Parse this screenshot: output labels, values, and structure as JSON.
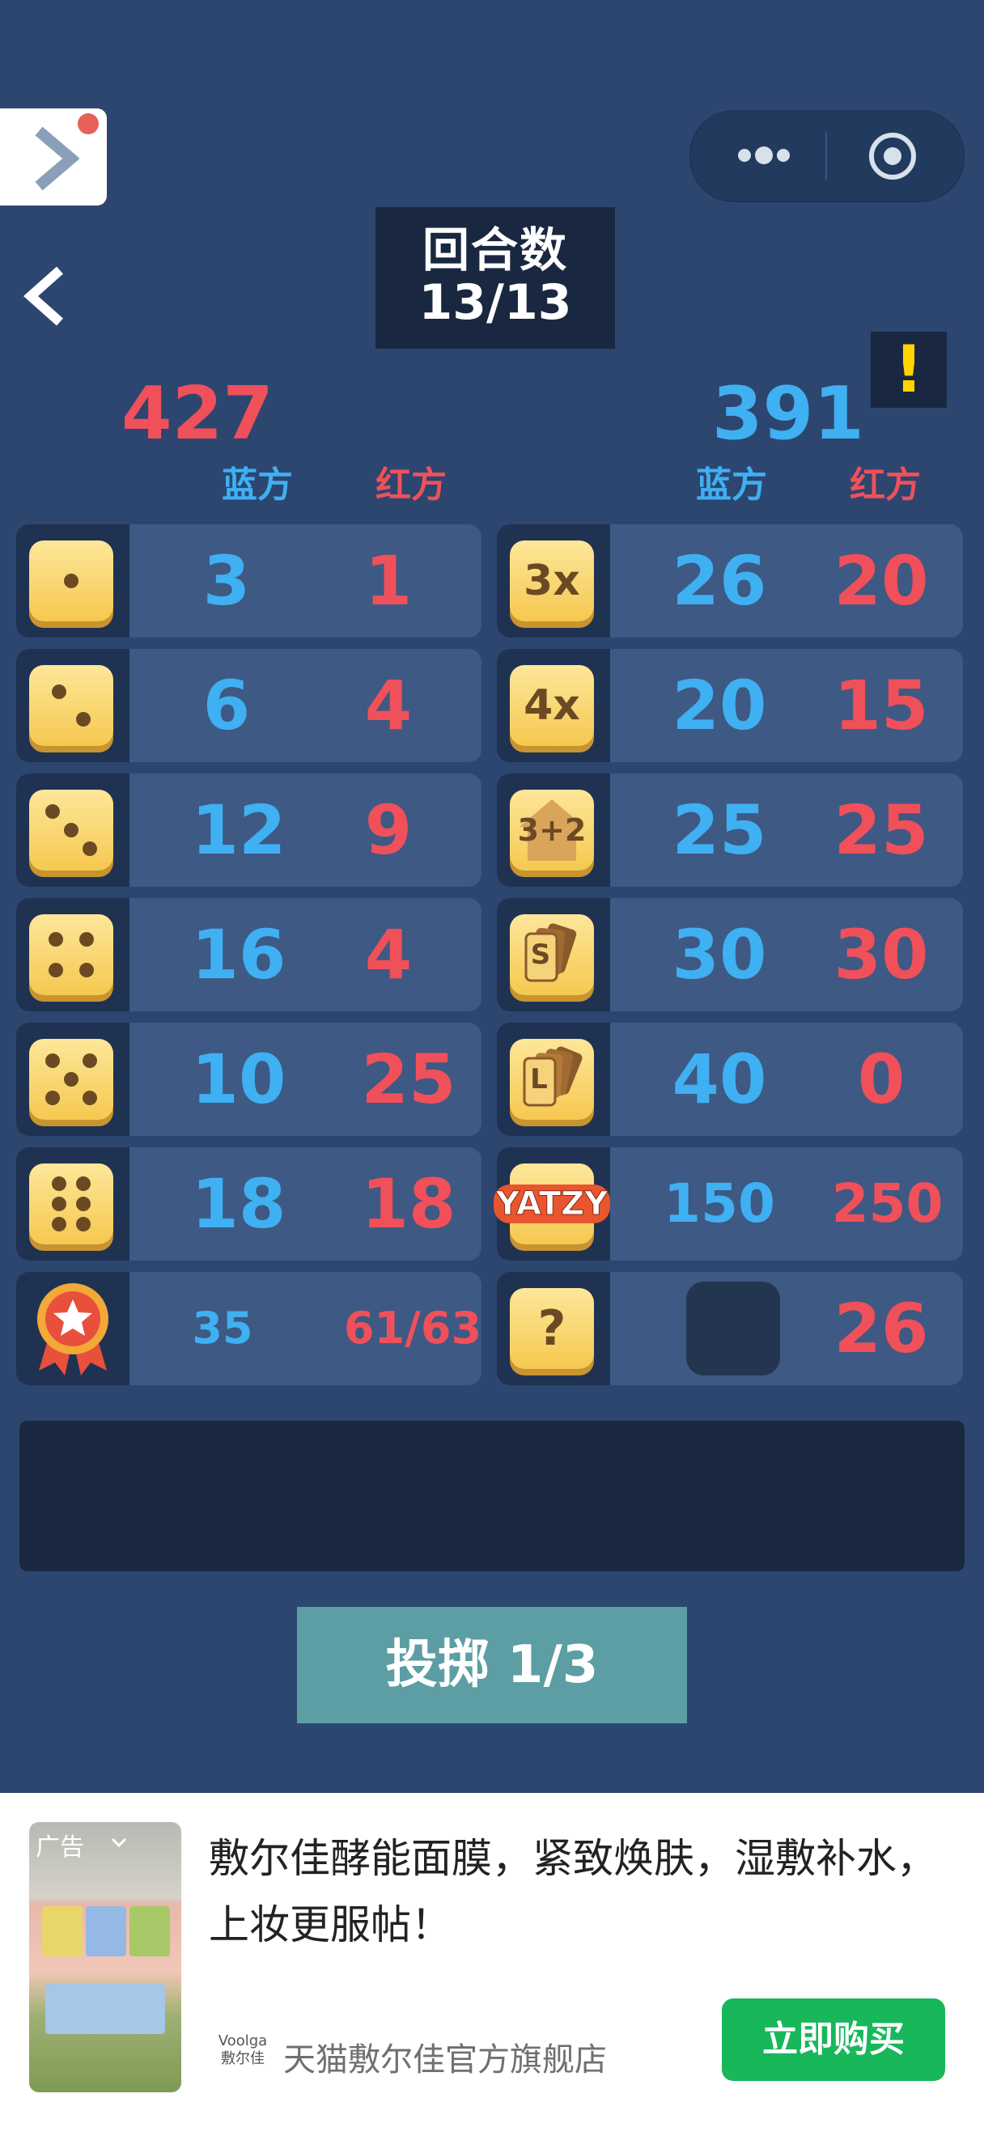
{
  "nav": {
    "icon": "chevron-right-icon",
    "back_icon": "chevron-left-icon",
    "menu_icon": "more-dots-icon",
    "close_icon": "target-circle-icon"
  },
  "round": {
    "label": "回合数",
    "value": "13/13"
  },
  "alert": "!",
  "totals": {
    "left": "427",
    "right": "391"
  },
  "headers": {
    "blue": "蓝方",
    "red": "红方"
  },
  "left_rows": [
    {
      "icon": "dice-one-icon",
      "blue": "3",
      "red": "1"
    },
    {
      "icon": "dice-two-icon",
      "blue": "6",
      "red": "4"
    },
    {
      "icon": "dice-three-icon",
      "blue": "12",
      "red": "9"
    },
    {
      "icon": "dice-four-icon",
      "blue": "16",
      "red": "4"
    },
    {
      "icon": "dice-five-icon",
      "blue": "10",
      "red": "25"
    },
    {
      "icon": "dice-six-icon",
      "blue": "18",
      "red": "18"
    },
    {
      "icon": "bonus-medal-icon",
      "blue": "35",
      "red": "61/63"
    }
  ],
  "right_rows": [
    {
      "icon": "three-of-kind-icon",
      "icon_text": "3x",
      "blue": "26",
      "red": "20"
    },
    {
      "icon": "four-of-kind-icon",
      "icon_text": "4x",
      "blue": "20",
      "red": "15"
    },
    {
      "icon": "full-house-icon",
      "icon_text": "3+2",
      "blue": "25",
      "red": "25"
    },
    {
      "icon": "small-straight-icon",
      "icon_text": "S",
      "blue": "30",
      "red": "30"
    },
    {
      "icon": "large-straight-icon",
      "icon_text": "L",
      "blue": "40",
      "red": "0"
    },
    {
      "icon": "yatzy-icon",
      "icon_text": "YATZY",
      "blue": "150",
      "red": "250"
    },
    {
      "icon": "chance-icon",
      "icon_text": "?",
      "blue": "",
      "red": "26"
    }
  ],
  "roll_button": "投掷 1/3",
  "colors": {
    "blue": "#3fb0f2",
    "red": "#f0505a",
    "background": "#2c4670",
    "roll": "#5c9ea4",
    "buy": "#17b75a"
  },
  "ad": {
    "tag": "广告",
    "title": "敷尔佳酵能面膜，紧致焕肤，湿敷补水，上妆更服帖！",
    "logo": "Voolga\n敷尔佳",
    "store": "天猫敷尔佳官方旗舰店",
    "button": "立即购买"
  }
}
